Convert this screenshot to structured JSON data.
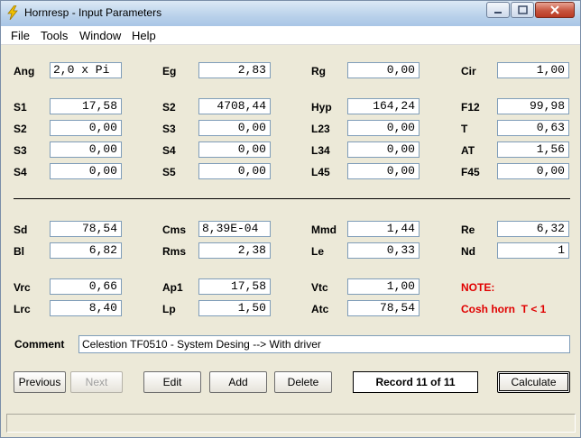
{
  "window": {
    "title": "Hornresp - Input Parameters"
  },
  "menu": [
    "File",
    "Tools",
    "Window",
    "Help"
  ],
  "params": {
    "Ang": {
      "label": "Ang",
      "value": "2,0 x Pi"
    },
    "Eg": {
      "label": "Eg",
      "value": "2,83"
    },
    "Rg": {
      "label": "Rg",
      "value": "0,00"
    },
    "Cir": {
      "label": "Cir",
      "value": "1,00"
    },
    "S1": {
      "label": "S1",
      "value": "17,58"
    },
    "S2a": {
      "label": "S2",
      "value": "4708,44"
    },
    "Hyp": {
      "label": "Hyp",
      "value": "164,24"
    },
    "F12": {
      "label": "F12",
      "value": "99,98"
    },
    "S2": {
      "label": "S2",
      "value": "0,00"
    },
    "S3a": {
      "label": "S3",
      "value": "0,00"
    },
    "L23": {
      "label": "L23",
      "value": "0,00"
    },
    "T": {
      "label": "T",
      "value": "0,63"
    },
    "S3": {
      "label": "S3",
      "value": "0,00"
    },
    "S4a": {
      "label": "S4",
      "value": "0,00"
    },
    "L34": {
      "label": "L34",
      "value": "0,00"
    },
    "AT": {
      "label": "AT",
      "value": "1,56"
    },
    "S4": {
      "label": "S4",
      "value": "0,00"
    },
    "S5": {
      "label": "S5",
      "value": "0,00"
    },
    "L45": {
      "label": "L45",
      "value": "0,00"
    },
    "F45": {
      "label": "F45",
      "value": "0,00"
    },
    "Sd": {
      "label": "Sd",
      "value": "78,54"
    },
    "Cms": {
      "label": "Cms",
      "value": "8,39E-04"
    },
    "Mmd": {
      "label": "Mmd",
      "value": "1,44"
    },
    "Re": {
      "label": "Re",
      "value": "6,32"
    },
    "Bl": {
      "label": "Bl",
      "value": "6,82"
    },
    "Rms": {
      "label": "Rms",
      "value": "2,38"
    },
    "Le": {
      "label": "Le",
      "value": "0,33"
    },
    "Nd": {
      "label": "Nd",
      "value": "1"
    },
    "Vrc": {
      "label": "Vrc",
      "value": "0,66"
    },
    "Ap1": {
      "label": "Ap1",
      "value": "17,58"
    },
    "Vtc": {
      "label": "Vtc",
      "value": "1,00"
    },
    "Lrc": {
      "label": "Lrc",
      "value": "8,40"
    },
    "Lp": {
      "label": "Lp",
      "value": "1,50"
    },
    "Atc": {
      "label": "Atc",
      "value": "78,54"
    }
  },
  "note": {
    "title": "NOTE:",
    "text": "Cosh horn  T < 1",
    "color": "#e00000"
  },
  "comment": {
    "label": "Comment",
    "value": "Celestion TF0510 - System Desing --> With driver"
  },
  "buttons": {
    "previous": "Previous",
    "next": "Next",
    "edit": "Edit",
    "add": "Add",
    "delete": "Delete",
    "calculate": "Calculate"
  },
  "record": "Record 11 of 11"
}
